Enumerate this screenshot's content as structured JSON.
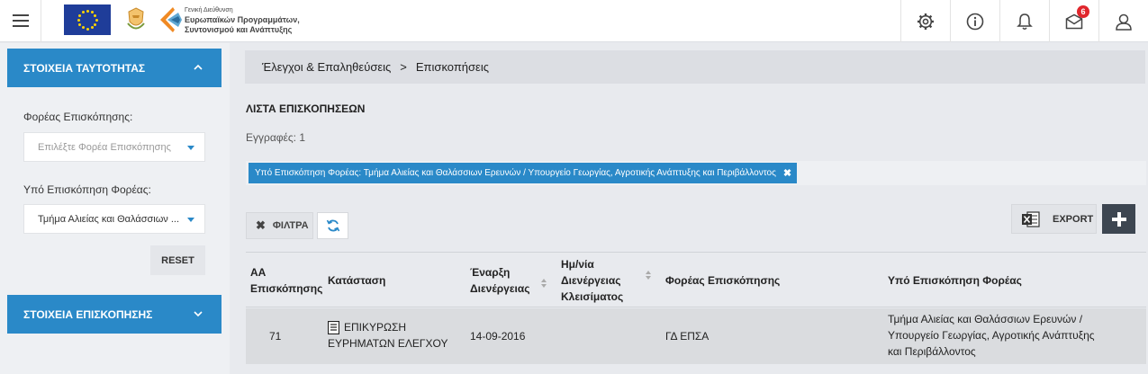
{
  "header": {
    "logo_text_small": "Γενική Διεύθυνση",
    "logo_text_line1": "Ευρωπαϊκών Προγραμμάτων,",
    "logo_text_line2": "Συντονισμού και Ανάπτυξης",
    "notifications_badge": "6",
    "icons": [
      "settings-icon",
      "info-icon",
      "bell-icon",
      "mail-icon",
      "user-icon"
    ]
  },
  "sidebar": {
    "panel1_title": "ΣΤΟΙΧΕΙΑ ΤΑΥΤΟΤΗΤΑΣ",
    "field1_label": "Φορέας Επισκόπησης:",
    "field1_placeholder": "Επιλέξτε Φορέα Επισκόπησης",
    "field2_label": "Υπό Επισκόπηση Φορέας:",
    "field2_value": "Τμήμα Αλιείας και Θαλάσσιων ...",
    "reset_label": "RESET",
    "panel2_title": "ΣΤΟΙΧΕΙΑ ΕΠΙΣΚΟΠΗΣΗΣ"
  },
  "main": {
    "breadcrumb": [
      "Έλεγχοι & Επαληθεύσεις",
      "Επισκοπήσεις"
    ],
    "breadcrumb_sep": ">",
    "list_title": "ΛΙΣΤΑ ΕΠΙΣΚΟΠΗΣΕΩΝ",
    "records_text": "Εγγραφές: 1",
    "filter_chip": "Υπό Επισκόπηση Φορέας: Τμήμα Αλιείας και Θαλάσσιων Ερευνών / Υπουργείο Γεωργίας, Αγροτικής Ανάπτυξης και Περιβάλλοντος",
    "filter_button": "ΦΙΛΤΡΑ",
    "export_button": "EXPORT",
    "accent_color": "#2a89c8"
  },
  "table": {
    "headers": {
      "aa_line1": "ΑΑ",
      "aa_line2": "Επισκόπησης",
      "status": "Κατάσταση",
      "start_line1": "Έναρξη",
      "start_line2": "Διενέργειας",
      "close_line1": "Ημ/νία",
      "close_line2": "Διενέργειας",
      "close_line3": "Κλεισίματος",
      "agency": "Φορέας Επισκόπησης",
      "reviewed": "Υπό Επισκόπηση Φορέας"
    },
    "rows": [
      {
        "aa": "71",
        "status_line1": "ΕΠΙΚΥΡΩΣΗ",
        "status_line2": "ΕΥΡΗΜΑΤΩΝ ΕΛΕΓΧΟΥ",
        "start": "14-09-2016",
        "close": "",
        "agency": "ΓΔ ΕΠΣΑ",
        "reviewed_line1": "Τμήμα Αλιείας και Θαλάσσιων Ερευνών /",
        "reviewed_line2": "Υπουργείο Γεωργίας, Αγροτικής Ανάπτυξης",
        "reviewed_line3": "και Περιβάλλοντος"
      }
    ]
  }
}
